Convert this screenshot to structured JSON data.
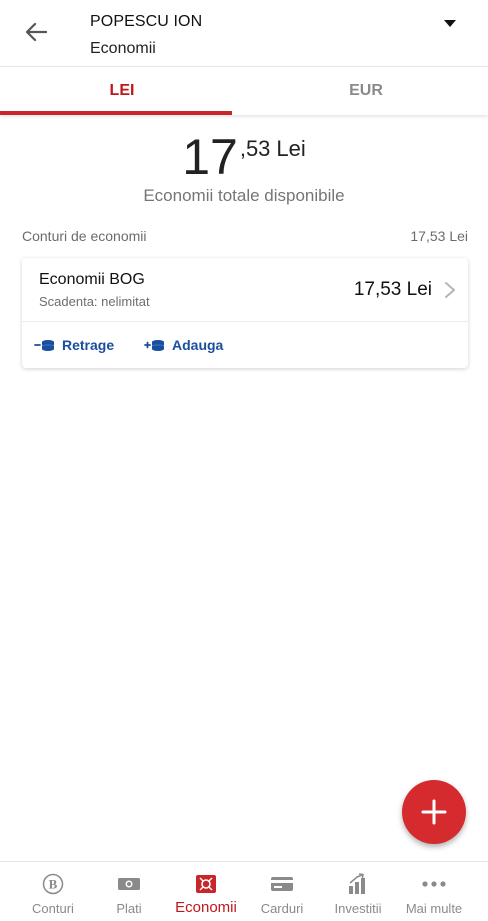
{
  "header": {
    "account_holder": "POPESCU ION",
    "subtitle": "Economii",
    "back_icon": "arrow-left-icon",
    "dropdown_icon": "caret-down-icon"
  },
  "tabs": [
    {
      "label": "LEI",
      "active": true
    },
    {
      "label": "EUR",
      "active": false
    }
  ],
  "balance": {
    "integer": "17",
    "decimals": ",53",
    "currency": "Lei",
    "label": "Economii totale disponibile"
  },
  "section": {
    "title": "Conturi de economii",
    "total": "17,53 Lei"
  },
  "account": {
    "name": "Economii BOG",
    "maturity": "Scadenta: nelimitat",
    "amount": "17,53 Lei",
    "actions": {
      "withdraw": "Retrage",
      "add": "Adauga"
    }
  },
  "fab": {
    "icon": "plus-icon"
  },
  "bottom_nav": [
    {
      "label": "Conturi",
      "icon": "bank-logo-icon",
      "active": false
    },
    {
      "label": "Plati",
      "icon": "banknote-icon",
      "active": false
    },
    {
      "label": "Economii",
      "icon": "safe-icon",
      "active": true
    },
    {
      "label": "Carduri",
      "icon": "card-icon",
      "active": false
    },
    {
      "label": "Investitii",
      "icon": "bar-chart-icon",
      "active": false
    },
    {
      "label": "Mai multe",
      "icon": "more-dots-icon",
      "active": false
    }
  ],
  "colors": {
    "accent": "#c9262b",
    "link_blue": "#1a4fa0",
    "muted": "#8a8a8a"
  }
}
